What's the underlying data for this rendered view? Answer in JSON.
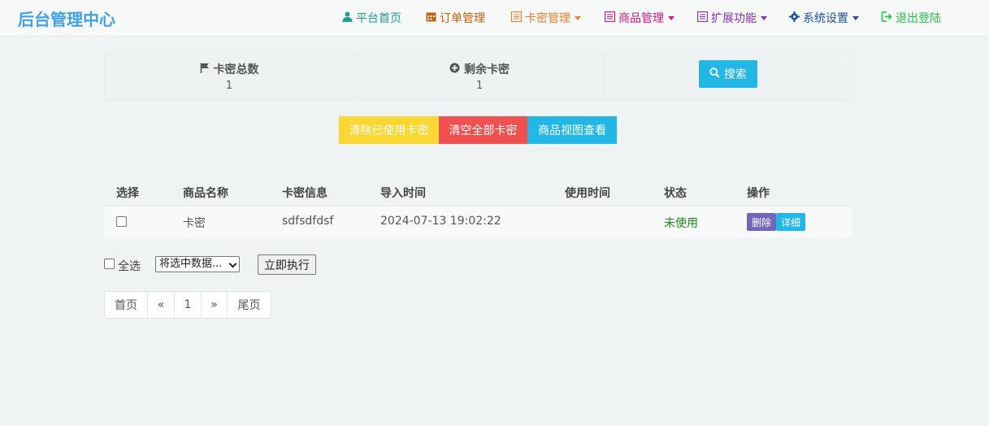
{
  "brand": "后台管理中心",
  "nav": {
    "home": "平台首页",
    "orders": "订单管理",
    "cards": "卡密管理",
    "goods": "商品管理",
    "extend": "扩展功能",
    "settings": "系统设置",
    "logout": "退出登陆"
  },
  "stats": {
    "total_label": "卡密总数",
    "total_value": "1",
    "remain_label": "剩余卡密",
    "remain_value": "1",
    "search_label": "搜索"
  },
  "actions": {
    "clear_used": "清除已使用卡密",
    "clear_all": "清空全部卡密",
    "view_goods": "商品视图查看"
  },
  "table": {
    "headers": [
      "选择",
      "商品名称",
      "卡密信息",
      "导入时间",
      "使用时间",
      "状态",
      "操作"
    ],
    "rows": [
      {
        "goods": "卡密",
        "card": "sdfsdfdsf",
        "import_time": "2024-07-13 19:02:22",
        "use_time": "",
        "status": "未使用",
        "delete": "删除",
        "detail": "详细"
      }
    ]
  },
  "bulk": {
    "select_all": "全选",
    "select_value": "将选中数据...",
    "execute": "立即执行"
  },
  "pager": {
    "first": "首页",
    "prev": "«",
    "current": "1",
    "next": "»",
    "last": "尾页"
  },
  "colors": {
    "brand": "#3fa1e6",
    "home": "#1aa094",
    "orders": "#c8610c",
    "cards": "#f07e2b",
    "goods": "#d41882",
    "extend": "#8a2fb8",
    "settings": "#1a4f9c",
    "logout": "#27c24c",
    "info": "#23b7e5",
    "warning": "#fad733",
    "danger": "#f05050",
    "purple": "#7266ba",
    "success_text": "#1a8a1a"
  }
}
